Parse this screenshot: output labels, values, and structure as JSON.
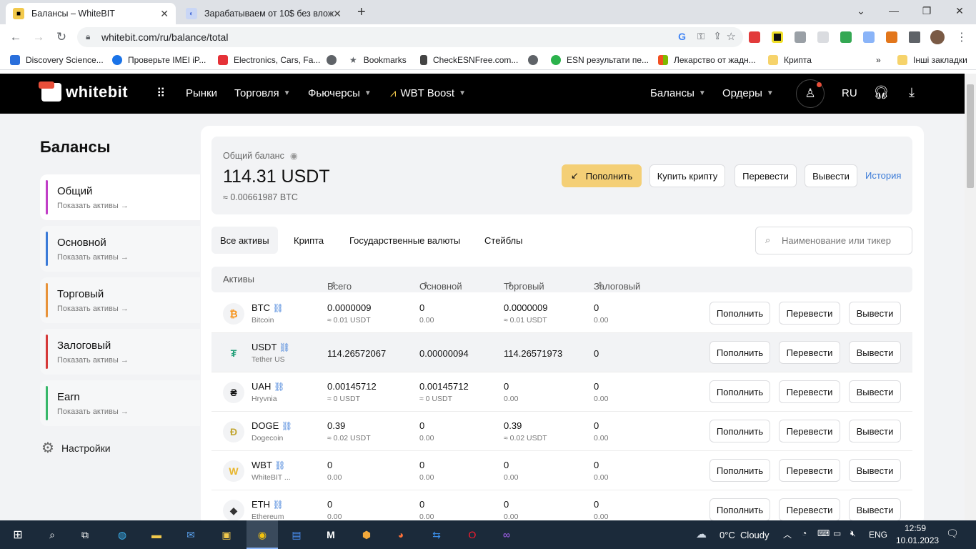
{
  "browser": {
    "tabs": [
      {
        "title": "Балансы – WhiteBIT",
        "active": true
      },
      {
        "title": "Зарабатываем от 10$ без влож",
        "active": false
      }
    ],
    "new_tab": "+",
    "url": "whitebit.com/ru/balance/total",
    "bookmarks": [
      {
        "label": "Discovery Science..."
      },
      {
        "label": "Проверьте IMEI iP..."
      },
      {
        "label": "Electronics, Cars, Fa..."
      },
      {
        "label": ""
      },
      {
        "label": "Bookmarks"
      },
      {
        "label": "CheckESNFree.com..."
      },
      {
        "label": ""
      },
      {
        "label": "ESN результати пе..."
      },
      {
        "label": "Лекарство от жадн..."
      },
      {
        "label": "Крипта"
      }
    ],
    "bookmarks_more": "»",
    "other_bookmarks": "Інші закладки"
  },
  "nav": {
    "logo": "whitebit",
    "items": [
      "Рынки",
      "Торговля",
      "Фьючерсы",
      "WBT Boost"
    ],
    "right_items": [
      "Балансы",
      "Ордеры"
    ],
    "lang": "RU"
  },
  "sidebar": {
    "title": "Балансы",
    "cards": [
      {
        "name": "Общий",
        "sub": "Показать активы",
        "color": "#c13ec7"
      },
      {
        "name": "Основной",
        "sub": "Показать активы",
        "color": "#3b7bd8"
      },
      {
        "name": "Торговый",
        "sub": "Показать активы",
        "color": "#e8933a"
      },
      {
        "name": "Залоговый",
        "sub": "Показать активы",
        "color": "#d63a3a"
      },
      {
        "name": "Earn",
        "sub": "Показать активы",
        "color": "#38b86a"
      }
    ],
    "settings": "Настройки"
  },
  "summary": {
    "label": "Общий баланс",
    "amount": "114.31 USDT",
    "btc": "≈ 0.00661987 BTC",
    "deposit": "Пополнить",
    "buy": "Купить крипту",
    "transfer": "Перевести",
    "withdraw": "Вывести",
    "history": "История"
  },
  "filters": {
    "tabs": [
      "Все активы",
      "Крипта",
      "Государственные валюты",
      "Стейблы"
    ],
    "search_placeholder": "Наименование или тикер"
  },
  "table": {
    "headers": [
      "Активы",
      "Всего",
      "Основной",
      "Торговый",
      "Залоговый"
    ],
    "actions": [
      "Пополнить",
      "Перевести",
      "Вывести"
    ],
    "rows": [
      {
        "ticker": "BTC",
        "name": "Bitcoin",
        "icon": "₿",
        "icon_color": "#f7931a",
        "total": "0.0000009",
        "total_sub": "≈ 0.01 USDT",
        "main": "0",
        "main_sub": "0.00",
        "trade": "0.0000009",
        "trade_sub": "≈ 0.01 USDT",
        "coll": "0",
        "coll_sub": "0.00"
      },
      {
        "ticker": "USDT",
        "name": "Tether US",
        "icon": "₮",
        "icon_color": "#26a17b",
        "total": "114.26572067",
        "total_sub": "",
        "main": "0.00000094",
        "main_sub": "",
        "trade": "114.26571973",
        "trade_sub": "",
        "coll": "0",
        "coll_sub": ""
      },
      {
        "ticker": "UAH",
        "name": "Hryvnia",
        "icon": "₴",
        "icon_color": "#111111",
        "total": "0.00145712",
        "total_sub": "≈ 0 USDT",
        "main": "0.00145712",
        "main_sub": "≈ 0 USDT",
        "trade": "0",
        "trade_sub": "0.00",
        "coll": "0",
        "coll_sub": "0.00"
      },
      {
        "ticker": "DOGE",
        "name": "Dogecoin",
        "icon": "Ð",
        "icon_color": "#c2a633",
        "total": "0.39",
        "total_sub": "≈ 0.02 USDT",
        "main": "0",
        "main_sub": "0.00",
        "trade": "0.39",
        "trade_sub": "≈ 0.02 USDT",
        "coll": "0",
        "coll_sub": "0.00"
      },
      {
        "ticker": "WBT",
        "name": "WhiteBIT ...",
        "icon": "W",
        "icon_color": "#e8b52a",
        "total": "0",
        "total_sub": "0.00",
        "main": "0",
        "main_sub": "0.00",
        "trade": "0",
        "trade_sub": "0.00",
        "coll": "0",
        "coll_sub": "0.00"
      },
      {
        "ticker": "ETH",
        "name": "Ethereum",
        "icon": "◆",
        "icon_color": "#333333",
        "total": "0",
        "total_sub": "0.00",
        "main": "0",
        "main_sub": "0.00",
        "trade": "0",
        "trade_sub": "0.00",
        "coll": "0",
        "coll_sub": "0.00"
      }
    ]
  },
  "taskbar": {
    "weather": "0°C  Cloudy",
    "lang": "ENG",
    "time": "12:59",
    "date": "10.01.2023"
  }
}
